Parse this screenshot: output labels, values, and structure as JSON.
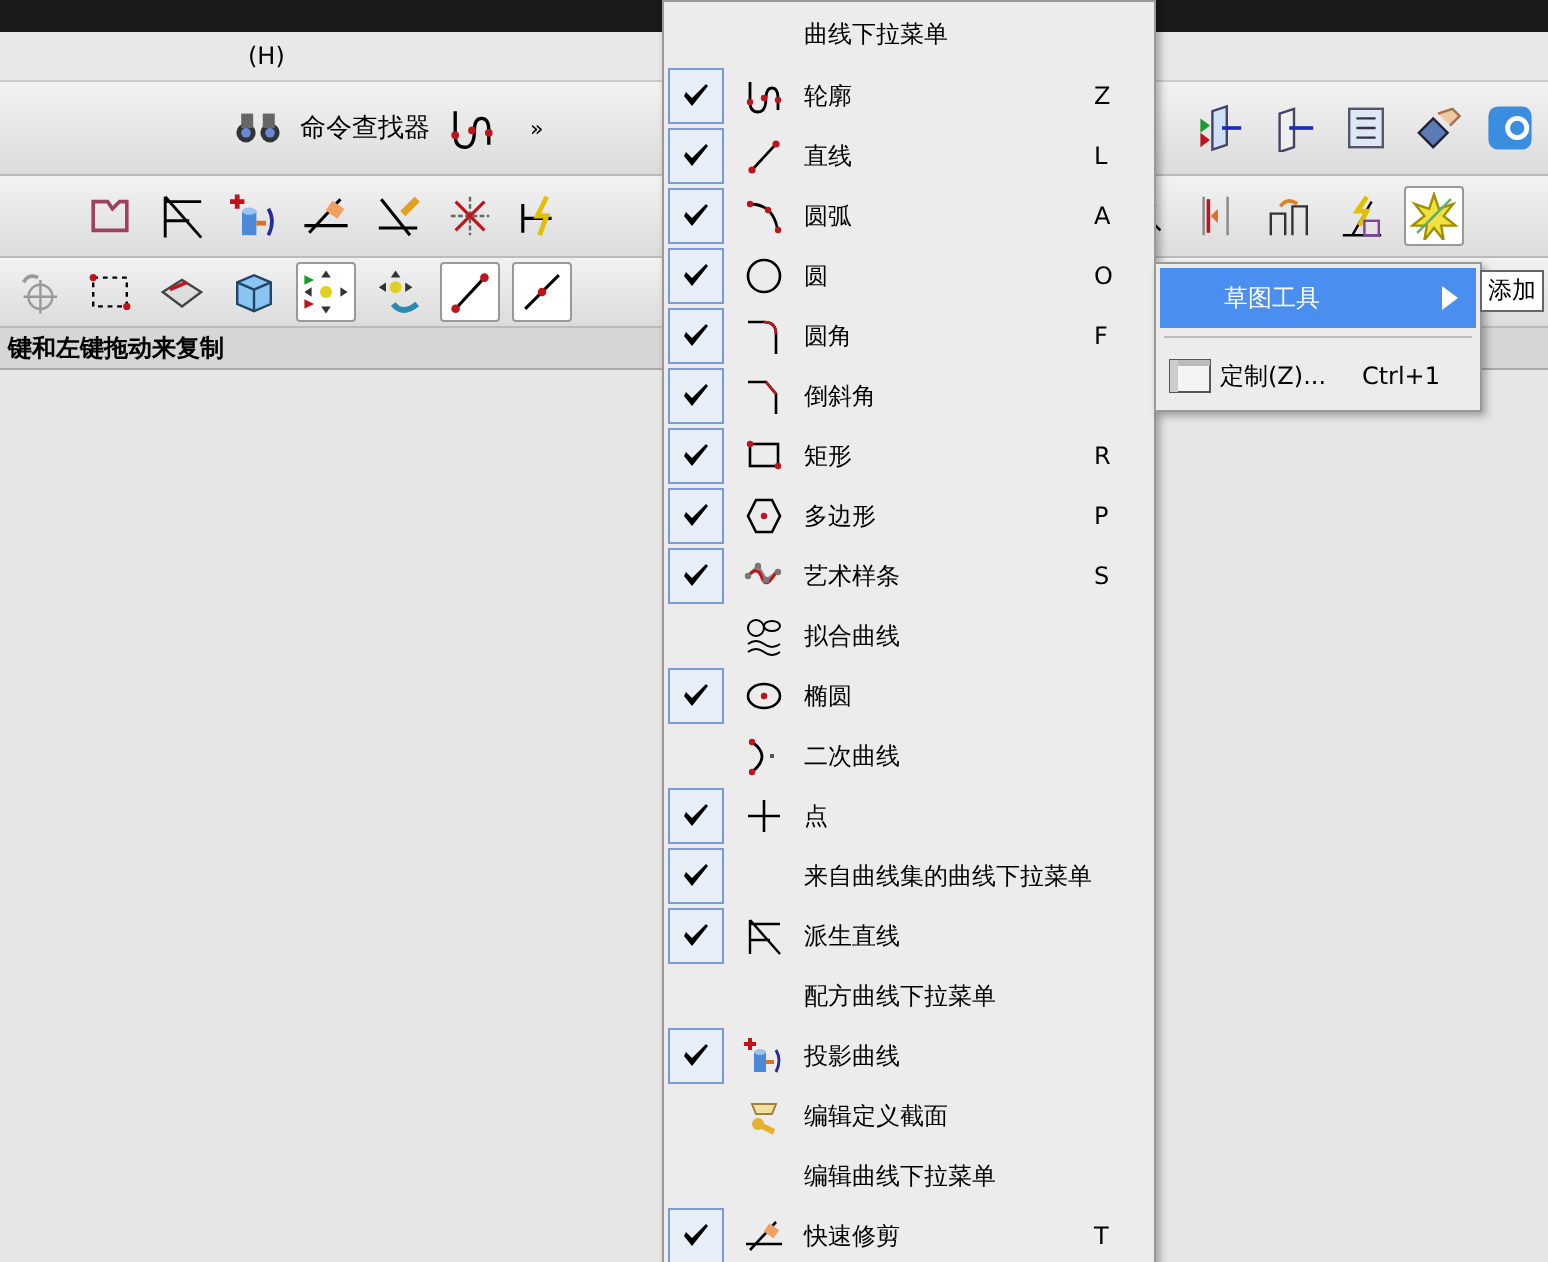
{
  "menubar": {
    "items": [
      "(H)"
    ]
  },
  "toolbar_1": {
    "finder_label": "命令查找器",
    "more": "»",
    "left": [
      {
        "kind": "binoculars",
        "pressed": false
      }
    ],
    "right": [
      {
        "kind": "profile",
        "pressed": false
      }
    ],
    "far": [
      {
        "kind": "arrow-box",
        "pressed": false
      },
      {
        "kind": "arrow-box-plain",
        "pressed": false
      },
      {
        "kind": "list",
        "pressed": false
      },
      {
        "kind": "hand",
        "pressed": false
      },
      {
        "kind": "tab",
        "pressed": false
      }
    ]
  },
  "toolbar_2": [
    {
      "kind": "shape",
      "pressed": false
    },
    {
      "kind": "derived",
      "pressed": false
    },
    {
      "kind": "project",
      "pressed": false
    },
    {
      "kind": "trim",
      "pressed": false
    },
    {
      "kind": "extend",
      "pressed": false
    },
    {
      "kind": "corner",
      "pressed": false
    },
    {
      "kind": "dimension",
      "pressed": false
    }
  ],
  "toolbar_2_right": [
    {
      "kind": "mirror",
      "pressed": false
    },
    {
      "kind": "offset",
      "pressed": false
    },
    {
      "kind": "pattern",
      "pressed": false
    },
    {
      "kind": "lightning",
      "pressed": false
    },
    {
      "kind": "spark",
      "pressed": true
    }
  ],
  "toolbar_3": [
    {
      "kind": "target",
      "pressed": false
    },
    {
      "kind": "rect-select",
      "pressed": false
    },
    {
      "kind": "eraser",
      "pressed": false
    },
    {
      "kind": "cube",
      "pressed": false
    },
    {
      "kind": "move",
      "pressed": true
    },
    {
      "kind": "move2",
      "pressed": false
    },
    {
      "kind": "line",
      "pressed": true
    },
    {
      "kind": "line-mid",
      "pressed": true
    }
  ],
  "status_bar": {
    "text": "键和左键拖动来复制"
  },
  "menu": {
    "items": [
      {
        "label": "曲线下拉菜单",
        "kind": "none",
        "checked": false
      },
      {
        "label": "轮廓",
        "kind": "profile",
        "checked": true,
        "shortcut": "Z"
      },
      {
        "label": "直线",
        "kind": "line",
        "checked": true,
        "shortcut": "L"
      },
      {
        "label": "圆弧",
        "kind": "arc",
        "checked": true,
        "shortcut": "A"
      },
      {
        "label": "圆",
        "kind": "circle",
        "checked": true,
        "shortcut": "O"
      },
      {
        "label": "圆角",
        "kind": "fillet",
        "checked": true,
        "shortcut": "F"
      },
      {
        "label": "倒斜角",
        "kind": "chamfer",
        "checked": true
      },
      {
        "label": "矩形",
        "kind": "rectangle",
        "checked": true,
        "shortcut": "R"
      },
      {
        "label": "多边形",
        "kind": "polygon",
        "checked": true,
        "shortcut": "P"
      },
      {
        "label": "艺术样条",
        "kind": "spline",
        "checked": true,
        "shortcut": "S"
      },
      {
        "label": "拟合曲线",
        "kind": "fit",
        "checked": false
      },
      {
        "label": "椭圆",
        "kind": "ellipse",
        "checked": true
      },
      {
        "label": "二次曲线",
        "kind": "conic",
        "checked": false
      },
      {
        "label": "点",
        "kind": "point",
        "checked": true
      },
      {
        "label": "来自曲线集的曲线下拉菜单",
        "kind": "none",
        "checked": true
      },
      {
        "label": "派生直线",
        "kind": "derived",
        "checked": true
      },
      {
        "label": "配方曲线下拉菜单",
        "kind": "none",
        "checked": false
      },
      {
        "label": "投影曲线",
        "kind": "project",
        "checked": true
      },
      {
        "label": "编辑定义截面",
        "kind": "section",
        "checked": false
      },
      {
        "label": "编辑曲线下拉菜单",
        "kind": "none",
        "checked": false
      },
      {
        "label": "快速修剪",
        "kind": "trim",
        "checked": true,
        "shortcut": "T"
      }
    ]
  },
  "submenu": {
    "items": [
      {
        "kind": "submenu",
        "label": "草图工具",
        "selected": true
      },
      {
        "kind": "separator"
      },
      {
        "kind": "command",
        "label": "定制(Z)...",
        "shortcut": "Ctrl+1",
        "selected": false
      }
    ]
  },
  "tooltip": {
    "text": "添加"
  }
}
